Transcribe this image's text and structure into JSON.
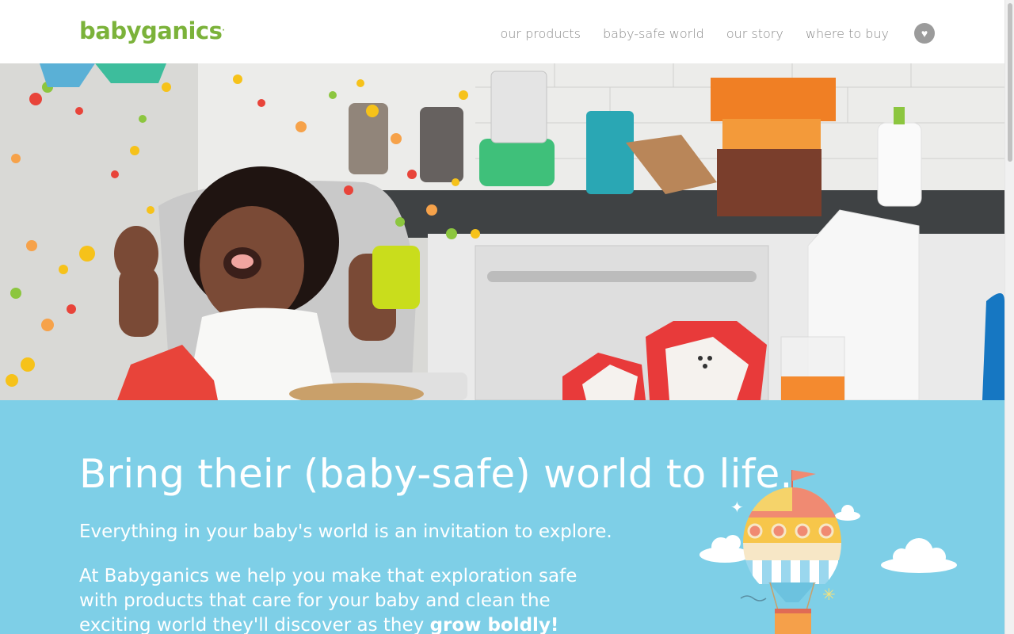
{
  "header": {
    "logo_text": "babyganics",
    "logo_mark": ".",
    "nav": [
      {
        "label": "our products"
      },
      {
        "label": "baby-safe world"
      },
      {
        "label": "our story"
      },
      {
        "label": "where to buy"
      }
    ],
    "heart_icon": "heart-icon"
  },
  "intro": {
    "headline": "Bring their (baby-safe) world to life.",
    "lead": "Everything in your baby's world is an invitation to explore.",
    "body_prefix": "At Babyganics we help you make that exploration safe with products that care for your baby and clean the exciting world they'll discover as they ",
    "body_strong": "grow boldly!"
  },
  "colors": {
    "brand_green": "#7bb23a",
    "nav_gray": "#8a8a8a",
    "intro_blue": "#7ecfe7"
  }
}
